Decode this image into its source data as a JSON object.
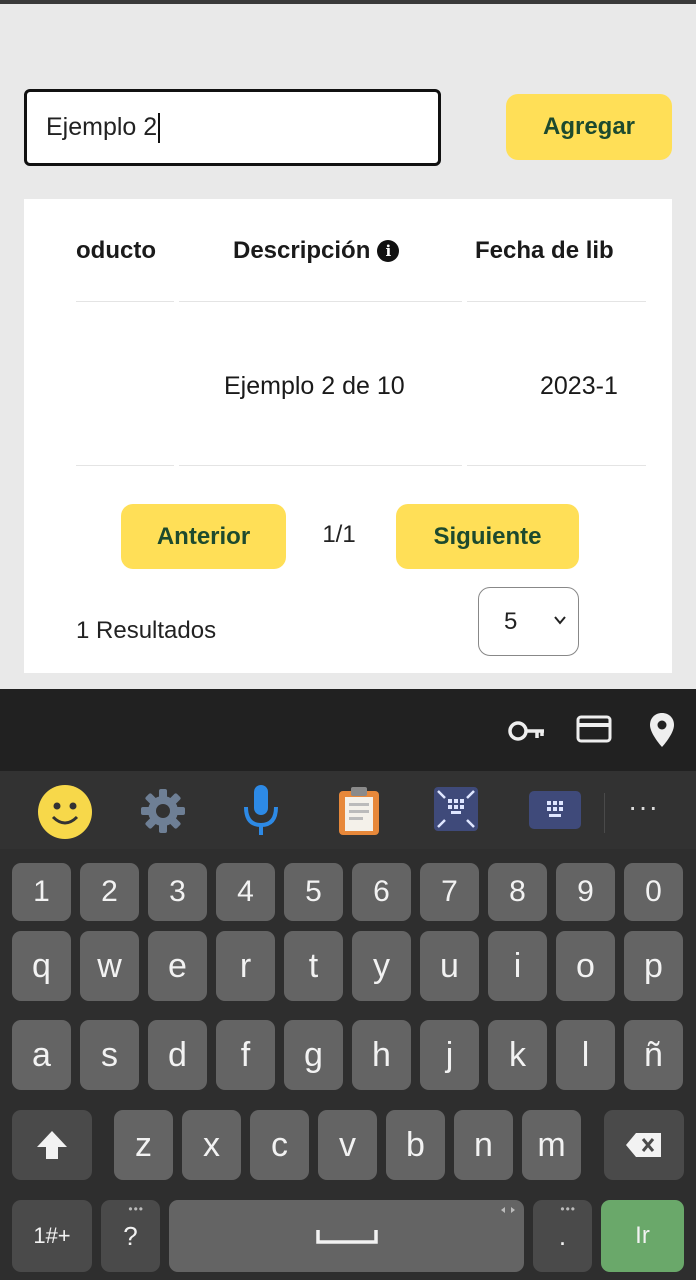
{
  "form": {
    "input_value": "Ejemplo 2",
    "add_button": "Agregar"
  },
  "table": {
    "headers": [
      "oducto",
      "Descripción",
      "Fecha de lib"
    ],
    "rows": [
      {
        "producto": "",
        "descripcion": "Ejemplo 2 de 10",
        "fecha": "2023-1"
      }
    ]
  },
  "pagination": {
    "prev": "Anterior",
    "page_indicator": "1/1",
    "next": "Siguiente",
    "results": "1 Resultados",
    "page_size": "5"
  },
  "keyboard": {
    "autofill_icons": [
      "key-icon",
      "credit-card-icon",
      "location-pin-icon"
    ],
    "toolbar_icons": [
      "emoji-icon",
      "settings-icon",
      "microphone-icon",
      "clipboard-icon",
      "resize-icon",
      "keyboard-icon",
      "more-icon"
    ],
    "more_label": "···",
    "row_numbers": [
      "1",
      "2",
      "3",
      "4",
      "5",
      "6",
      "7",
      "8",
      "9",
      "0"
    ],
    "row_1": [
      "q",
      "w",
      "e",
      "r",
      "t",
      "y",
      "u",
      "i",
      "o",
      "p"
    ],
    "row_2": [
      "a",
      "s",
      "d",
      "f",
      "g",
      "h",
      "j",
      "k",
      "l",
      "ñ"
    ],
    "row_3": [
      "z",
      "x",
      "c",
      "v",
      "b",
      "n",
      "m"
    ],
    "symbols_key": "1#+",
    "question_key": "?",
    "period_key": ".",
    "go_key": "Ir"
  },
  "colors": {
    "accent_yellow": "#ffdf57",
    "button_text": "#1d4a2e",
    "go_key": "#6aa86a"
  }
}
